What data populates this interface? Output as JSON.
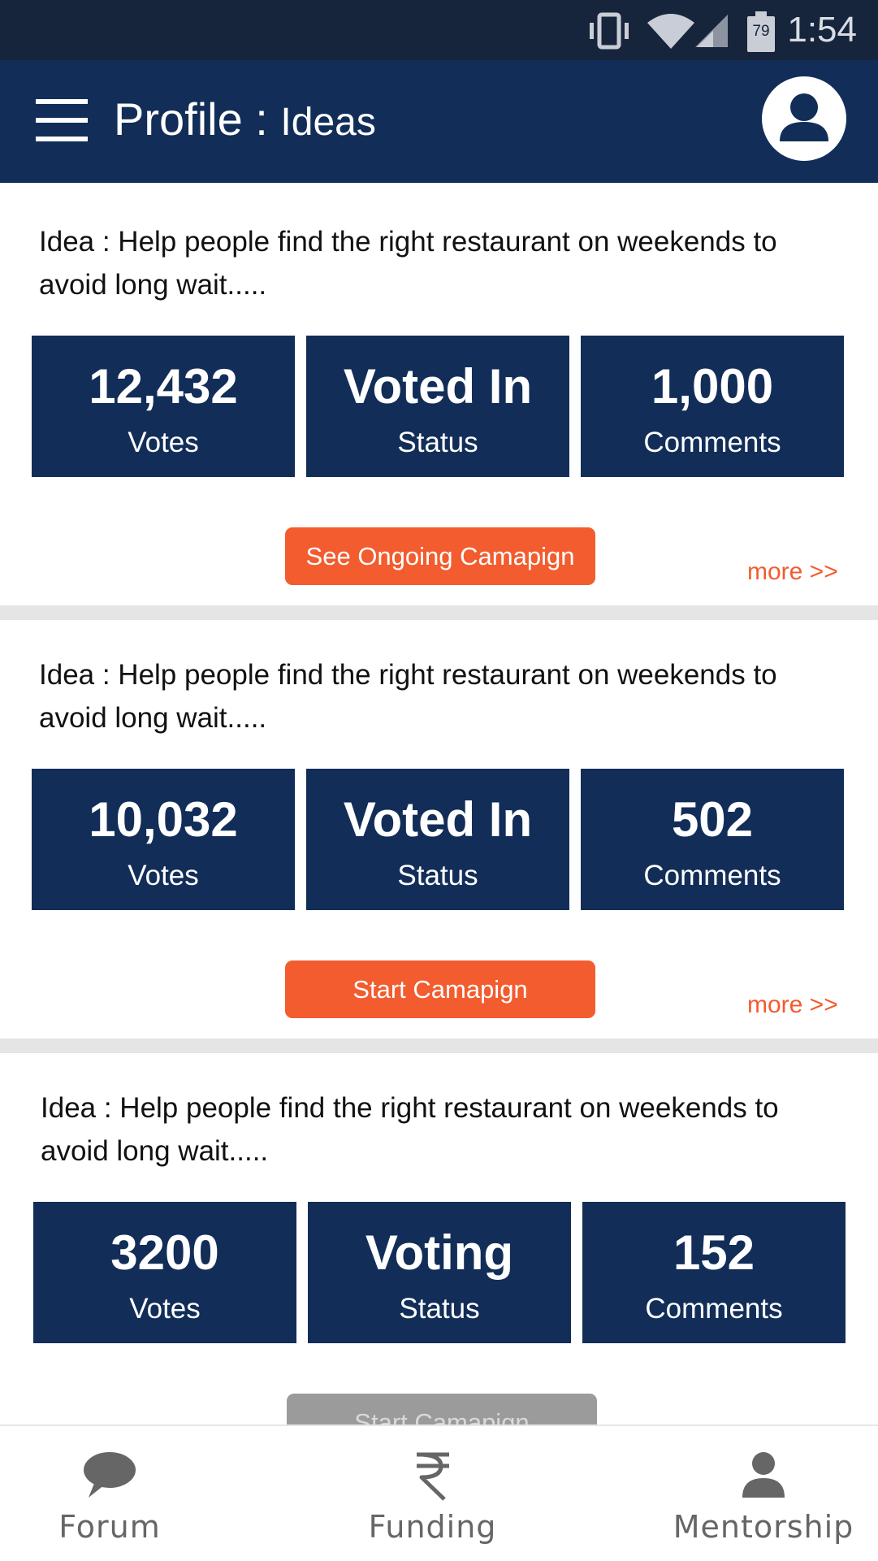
{
  "status_bar": {
    "time": "1:54",
    "battery_level": "79",
    "icons": [
      "vibrate-icon",
      "wifi-icon",
      "signal-icon",
      "battery-icon"
    ]
  },
  "header": {
    "title": "Profile",
    "separator": " : ",
    "subtitle": "Ideas"
  },
  "cards": [
    {
      "idea_line1": "Idea : Help people find the right restaurant on weekends to",
      "idea_line2": "avoid long wait.....",
      "stats": [
        {
          "value": "12,432",
          "label": "Votes"
        },
        {
          "value": "Voted In",
          "label": "Status"
        },
        {
          "value": "1,000",
          "label": "Comments"
        }
      ],
      "button": "See Ongoing Camapign",
      "more": "more >>"
    },
    {
      "idea_line1": "Idea : Help people find the right restaurant on weekends to",
      "idea_line2": "avoid long wait.....",
      "stats": [
        {
          "value": "10,032",
          "label": "Votes"
        },
        {
          "value": "Voted In",
          "label": "Status"
        },
        {
          "value": "502",
          "label": "Comments"
        }
      ],
      "button": "Start Camapign",
      "more": "more >>"
    },
    {
      "idea_line1": "Idea : Help people find the right restaurant on weekends to",
      "idea_line2": "avoid long wait.....",
      "stats": [
        {
          "value": "3200",
          "label": "Votes"
        },
        {
          "value": "Voting",
          "label": "Status"
        },
        {
          "value": "152",
          "label": "Comments"
        }
      ],
      "button": "Start Camapign"
    }
  ],
  "bottom_nav": [
    {
      "label": "Forum",
      "icon": "chat-bubble-icon"
    },
    {
      "label": "Funding",
      "icon": "rupee-icon"
    },
    {
      "label": "Mentorship",
      "icon": "person-icon"
    }
  ],
  "colors": {
    "primary_navy": "#122e58",
    "status_bar": "#17253c",
    "accent_orange": "#f25c2f",
    "disabled_gray": "#9b9b9b",
    "separator_gray": "#e5e5e5"
  }
}
